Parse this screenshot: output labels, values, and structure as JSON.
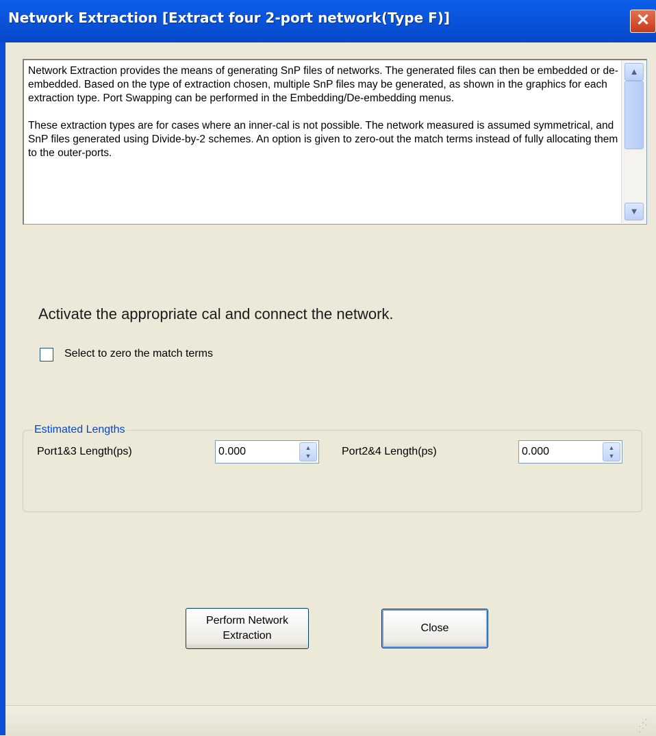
{
  "window": {
    "title": "Network Extraction [Extract four 2-port network(Type F)]",
    "close_glyph": "✕"
  },
  "description": {
    "paragraph1": "Network Extraction provides the means of generating SnP files of networks.  The generated files can then be embedded or de-embedded.  Based on the type of extraction chosen, multiple SnP files may be generated, as shown in the graphics for each extraction type.  Port Swapping can be performed in the Embedding/De-embedding menus.",
    "paragraph2": "These extraction types are for cases where an inner-cal is not possible.  The network measured is assumed symmetrical, and  SnP files generated using Divide-by-2 schemes.  An option is given to zero-out the match terms instead of fully allocating them to the outer-ports.",
    "scroll_up_glyph": "▲",
    "scroll_down_glyph": "▼"
  },
  "instruction": "Activate the appropriate cal and connect the network.",
  "zero_match": {
    "label": "Select to zero the match terms",
    "checked": false
  },
  "estimated_lengths": {
    "legend": "Estimated Lengths",
    "port13_label": "Port1&3 Length(ps)",
    "port13_value": "0.000",
    "port24_label": "Port2&4 Length(ps)",
    "port24_value": "0.000",
    "spin_glyph": "▲\n▼"
  },
  "buttons": {
    "perform_line1": "Perform Network",
    "perform_line2": "Extraction",
    "close": "Close"
  },
  "colors": {
    "title_bar": "#0b55dc",
    "dialog_bg": "#ece9d8",
    "group_legend": "#0046d5"
  }
}
